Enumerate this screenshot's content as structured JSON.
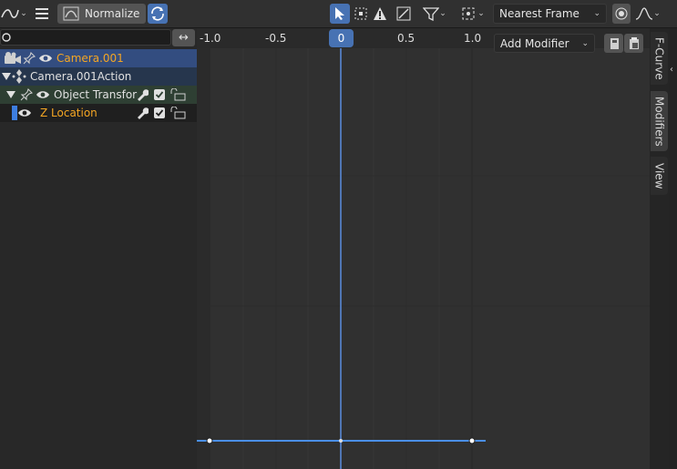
{
  "header": {
    "normalize_label": "Normalize",
    "snap_label": "Nearest Frame"
  },
  "channels": {
    "search_placeholder": "",
    "rows": [
      {
        "label": "Camera.001"
      },
      {
        "label": "Camera.001Action"
      },
      {
        "label": "Object Transform"
      },
      {
        "label": "Z Location"
      }
    ]
  },
  "ruler": {
    "ticks": [
      "-1.0",
      "-0.5",
      "0",
      "0.5",
      "1.0"
    ],
    "current_frame": "0"
  },
  "sidebar": {
    "add_modifier_label": "Add Modifier",
    "tabs": [
      "F-Curve",
      "Modifiers",
      "View"
    ],
    "active_tab": "Modifiers"
  },
  "colors": {
    "accent": "#4772b3",
    "curve": "#4a8fe7",
    "active_channel_text": "#f5a623",
    "selected_row": "#334d80"
  }
}
